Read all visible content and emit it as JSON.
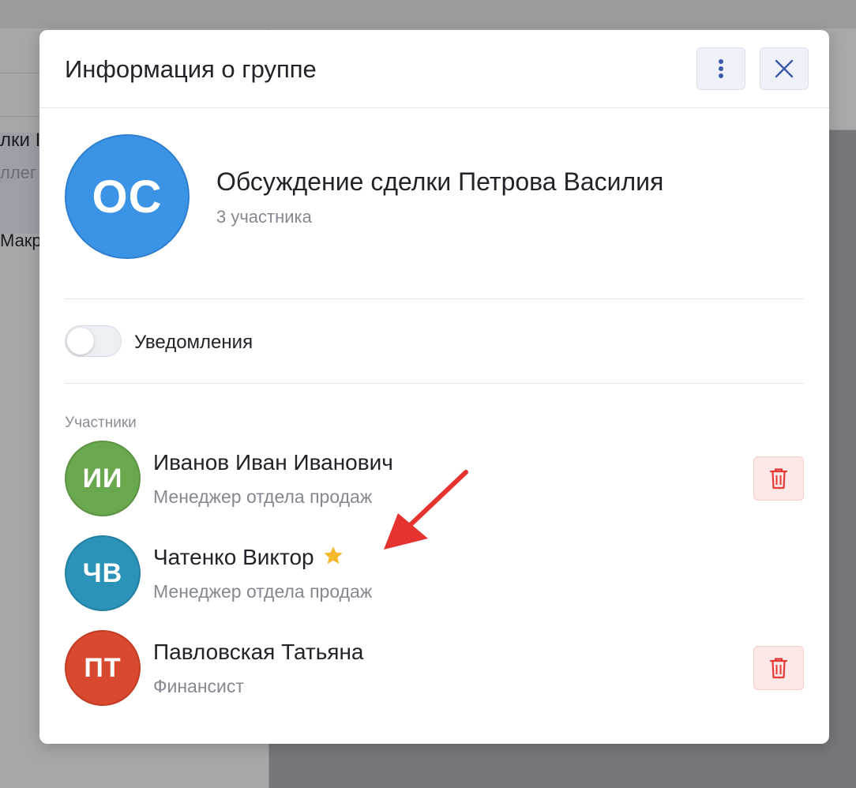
{
  "background": {
    "chat_text_1": "лки I",
    "chat_text_2": "ллег",
    "chat_text_3": "Макр"
  },
  "modal": {
    "title": "Информация о группе",
    "group": {
      "avatar_initials": "ОС",
      "name": "Обсуждение сделки Петрова Василия",
      "member_count": "3 участника"
    },
    "notifications": {
      "label": "Уведомления",
      "enabled": false
    },
    "members_section_label": "Участники",
    "members": [
      {
        "initials": "ИИ",
        "name": "Иванов Иван Иванович",
        "role": "Менеджер отдела продаж",
        "avatar_color": "#6aa84f",
        "removable": true
      },
      {
        "initials": "ЧВ",
        "name": "Чатенко Виктор",
        "role": "Менеджер отдела продаж",
        "avatar_color": "#2b92b8",
        "admin_icon": "star-icon",
        "removable": false
      },
      {
        "initials": "ПТ",
        "name": "Павловская Татьяна",
        "role": "Финансист",
        "avatar_color": "#d9492f",
        "removable": true
      }
    ]
  },
  "colors": {
    "group_avatar": "#3b93e6",
    "delete_icon": "#e53935",
    "star": "#f5b82e",
    "annotation_arrow": "#e53430"
  }
}
